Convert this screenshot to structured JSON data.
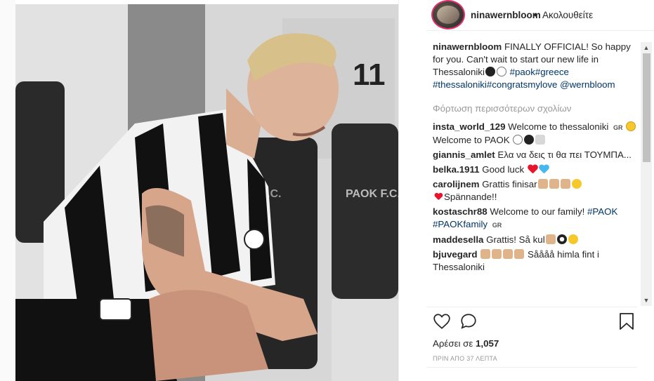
{
  "header": {
    "username": "ninawernbloom",
    "separator": "•",
    "follow_status": "Ακολουθείτε"
  },
  "caption": {
    "username": "ninawernbloom",
    "text": "FINALLY OFFICIAL! So happy for you. Can't wait to start our new life in Thessaloniki",
    "tags": "#paok#greece #thessaloniki#congratsmylove @wernbloom"
  },
  "load_more": "Φόρτωση περισσότερων σχολίων",
  "comments": [
    {
      "username": "insta_world_129",
      "text": "Welcome to thessaloniki",
      "badge": "GR",
      "text2": "Welcome to PAOK"
    },
    {
      "username": "giannis_amlet",
      "text": "Ελα να δεις τι θα πει ΤΟΥΜΠΑ..."
    },
    {
      "username": "belka.1911",
      "text": "Good luck"
    },
    {
      "username": "carolijnem",
      "text": "Grattis finisar",
      "text2": "Spännande!!"
    },
    {
      "username": "kostaschr88",
      "text": "Welcome to our family!",
      "tags": "#PAOK #PAOKfamily",
      "badge": "GR"
    },
    {
      "username": "maddesella",
      "text": "Grattis! Så kul"
    },
    {
      "username": "bjuvegard",
      "text": "Såååå himla fint i Thessaloniki"
    }
  ],
  "likes": {
    "label": "Αρέσει σε",
    "count": "1,057"
  },
  "timestamp": "ΠΡΙΝ ΑΠΟ 37 ΛΕΠΤΑ",
  "icons": {
    "like": "heart-outline-icon",
    "comment": "comment-bubble-icon",
    "save": "bookmark-icon"
  },
  "photo": {
    "jersey_number": "11",
    "locker_label_1": "PAOK F.C.",
    "locker_label_2": "F.C."
  },
  "colors": {
    "link": "#003569",
    "text": "#262626",
    "muted": "#999999",
    "heart_red": "#e8142c",
    "heart_blue": "#46b8ee"
  }
}
